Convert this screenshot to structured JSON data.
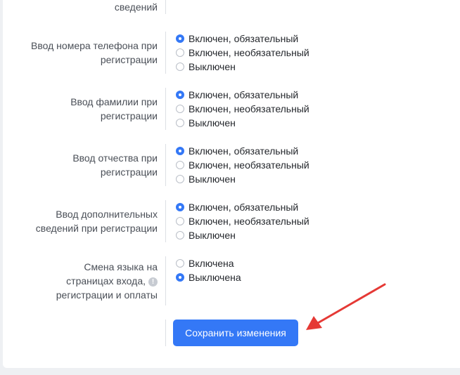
{
  "form": {
    "top_partial_label": "сведений",
    "groups": [
      {
        "label_lines": [
          "Ввод номера телефона при",
          "регистрации"
        ],
        "options": [
          {
            "label": "Включен, обязательный",
            "selected": true
          },
          {
            "label": "Включен, необязательный",
            "selected": false
          },
          {
            "label": "Выключен",
            "selected": false
          }
        ]
      },
      {
        "label_lines": [
          "Ввод фамилии при",
          "регистрации"
        ],
        "options": [
          {
            "label": "Включен, обязательный",
            "selected": true
          },
          {
            "label": "Включен, необязательный",
            "selected": false
          },
          {
            "label": "Выключен",
            "selected": false
          }
        ]
      },
      {
        "label_lines": [
          "Ввод отчества при",
          "регистрации"
        ],
        "options": [
          {
            "label": "Включен, обязательный",
            "selected": true
          },
          {
            "label": "Включен, необязательный",
            "selected": false
          },
          {
            "label": "Выключен",
            "selected": false
          }
        ]
      },
      {
        "label_lines": [
          "Ввод дополнительных",
          "сведений при регистрации"
        ],
        "options": [
          {
            "label": "Включен, обязательный",
            "selected": true
          },
          {
            "label": "Включен, необязательный",
            "selected": false
          },
          {
            "label": "Выключен",
            "selected": false
          }
        ]
      },
      {
        "label_lines": [
          "Смена языка на",
          "страницах входа,",
          "регистрации и оплаты"
        ],
        "info_icon": "info-icon",
        "options": [
          {
            "label": "Включена",
            "selected": false
          },
          {
            "label": "Выключена",
            "selected": true
          }
        ]
      }
    ],
    "save_label": "Сохранить изменения"
  },
  "annotation": {
    "arrow_color": "#e53935"
  }
}
